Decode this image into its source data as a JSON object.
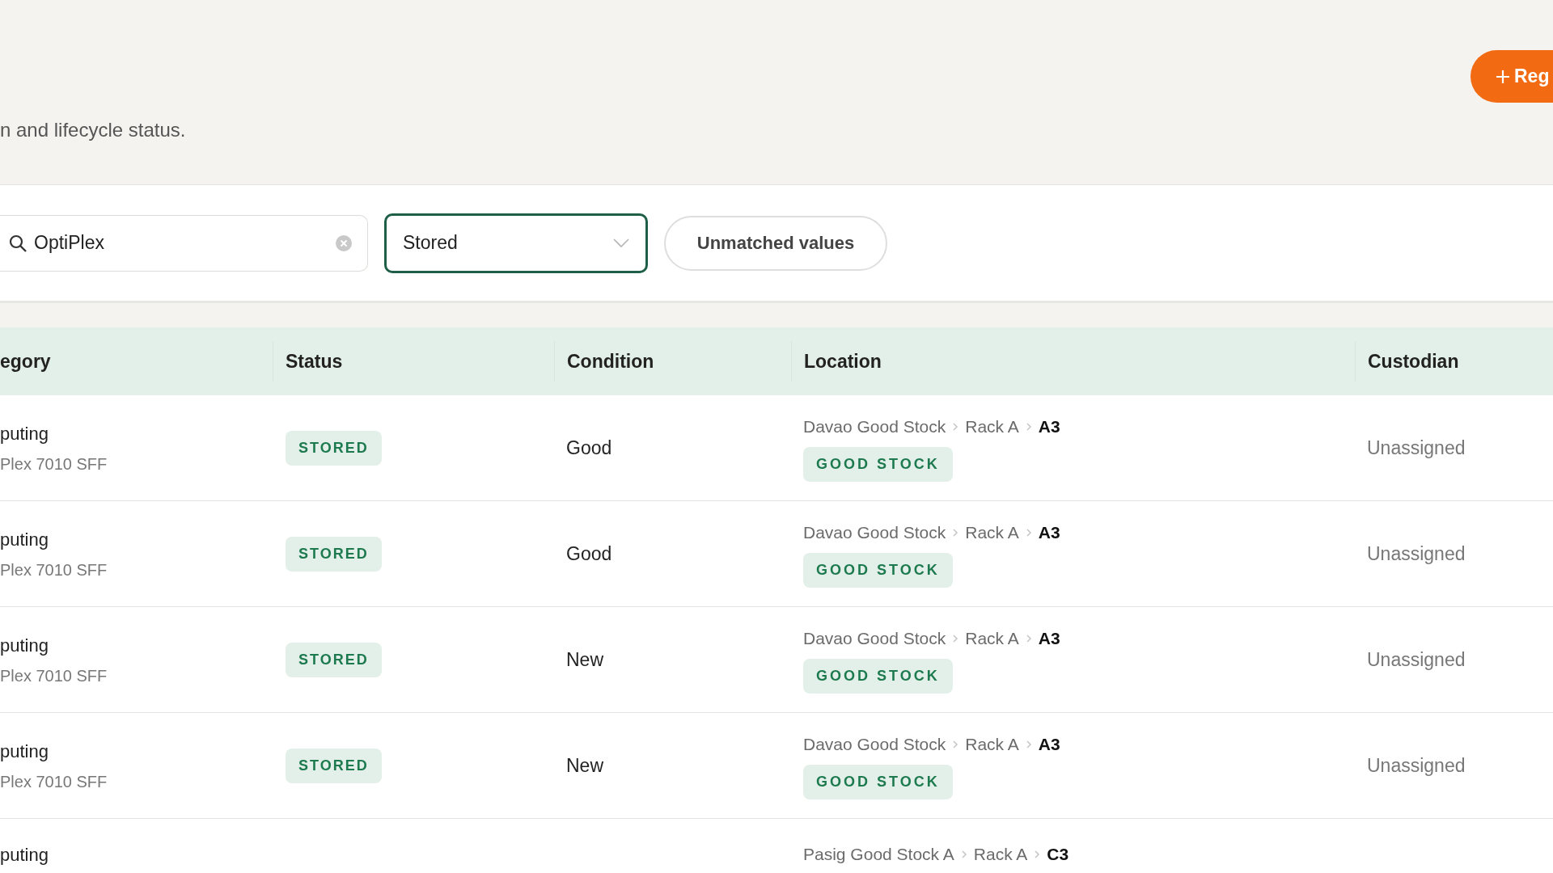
{
  "header": {
    "subtitle": "n and lifecycle status.",
    "primary_button": "Reg"
  },
  "filters": {
    "search": {
      "value": "OptiPlex"
    },
    "status_select": {
      "value": "Stored"
    },
    "unmatched_button": "Unmatched values"
  },
  "table": {
    "columns": [
      "egory",
      "Status",
      "Condition",
      "Location",
      "Custodian"
    ],
    "rows": [
      {
        "category": "puting",
        "model": "Plex 7010 SFF",
        "status": "STORED",
        "condition": "Good",
        "location": [
          "Davao Good Stock",
          "Rack A",
          "A3"
        ],
        "location_tag": "GOOD STOCK",
        "custodian": "Unassigned"
      },
      {
        "category": "puting",
        "model": "Plex 7010 SFF",
        "status": "STORED",
        "condition": "Good",
        "location": [
          "Davao Good Stock",
          "Rack A",
          "A3"
        ],
        "location_tag": "GOOD STOCK",
        "custodian": "Unassigned"
      },
      {
        "category": "puting",
        "model": "Plex 7010 SFF",
        "status": "STORED",
        "condition": "New",
        "location": [
          "Davao Good Stock",
          "Rack A",
          "A3"
        ],
        "location_tag": "GOOD STOCK",
        "custodian": "Unassigned"
      },
      {
        "category": "puting",
        "model": "Plex 7010 SFF",
        "status": "STORED",
        "condition": "New",
        "location": [
          "Davao Good Stock",
          "Rack A",
          "A3"
        ],
        "location_tag": "GOOD STOCK",
        "custodian": "Unassigned"
      },
      {
        "category": "puting",
        "location": [
          "Pasig Good Stock A",
          "Rack A",
          "C3"
        ]
      }
    ]
  }
}
